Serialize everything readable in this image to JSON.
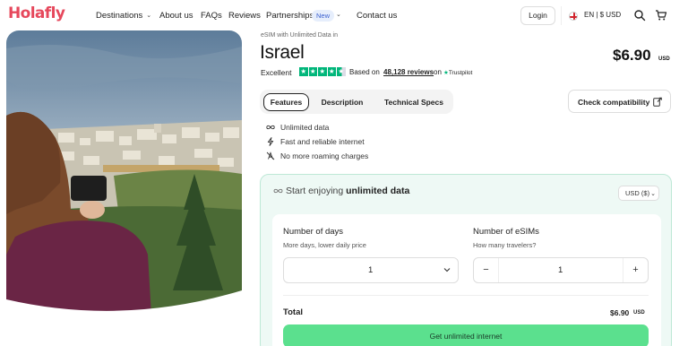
{
  "brand": {
    "logo_text": "Holafly",
    "accent": "#e6485c"
  },
  "nav": {
    "items": [
      {
        "label": "Destinations",
        "has_chevron": true
      },
      {
        "label": "About us"
      },
      {
        "label": "FAQs"
      },
      {
        "label": "Reviews"
      },
      {
        "label": "Partnerships",
        "badge": "New",
        "has_chevron": true
      },
      {
        "label": "Contact us"
      }
    ],
    "login_label": "Login",
    "language_label": "EN | $ USD",
    "icons": [
      "search-icon",
      "cart-icon"
    ]
  },
  "product": {
    "breadcrumb": "eSIM with Unlimited Data in",
    "title": "Israel",
    "price": "$6.90",
    "currency": "USD",
    "rating": {
      "label": "Excellent",
      "stars_shown": 4.5,
      "stars_max": 5,
      "based_on": "Based on",
      "reviews_text": "48,128 reviews",
      "on_word": "on",
      "provider": "Trustpilot",
      "star_color": "#00b67a"
    }
  },
  "tabs": [
    {
      "label": "Features",
      "active": true
    },
    {
      "label": "Description",
      "active": false
    },
    {
      "label": "Technical Specs",
      "active": false
    }
  ],
  "check_compatibility_label": "Check compatibility",
  "features": [
    {
      "icon": "infinity-icon",
      "text": "Unlimited data"
    },
    {
      "icon": "lightning-icon",
      "text": "Fast and reliable internet"
    },
    {
      "icon": "no-roaming-icon",
      "text": "No more roaming charges"
    }
  ],
  "purchase": {
    "heading_prefix": "Start enjoying",
    "heading_bold": "unlimited data",
    "currency_select": "USD ($)",
    "days": {
      "label": "Number of days",
      "sublabel": "More days, lower daily price",
      "value": "1"
    },
    "esims": {
      "label": "Number of eSIMs",
      "sublabel": "How many travelers?",
      "value": "1",
      "minus": "−",
      "plus": "+"
    },
    "total_label": "Total",
    "total_value": "$6.90",
    "total_currency": "USD",
    "cta_label": "Get unlimited internet",
    "panel_color": "#eef9f5",
    "cta_color": "#5be08e"
  }
}
